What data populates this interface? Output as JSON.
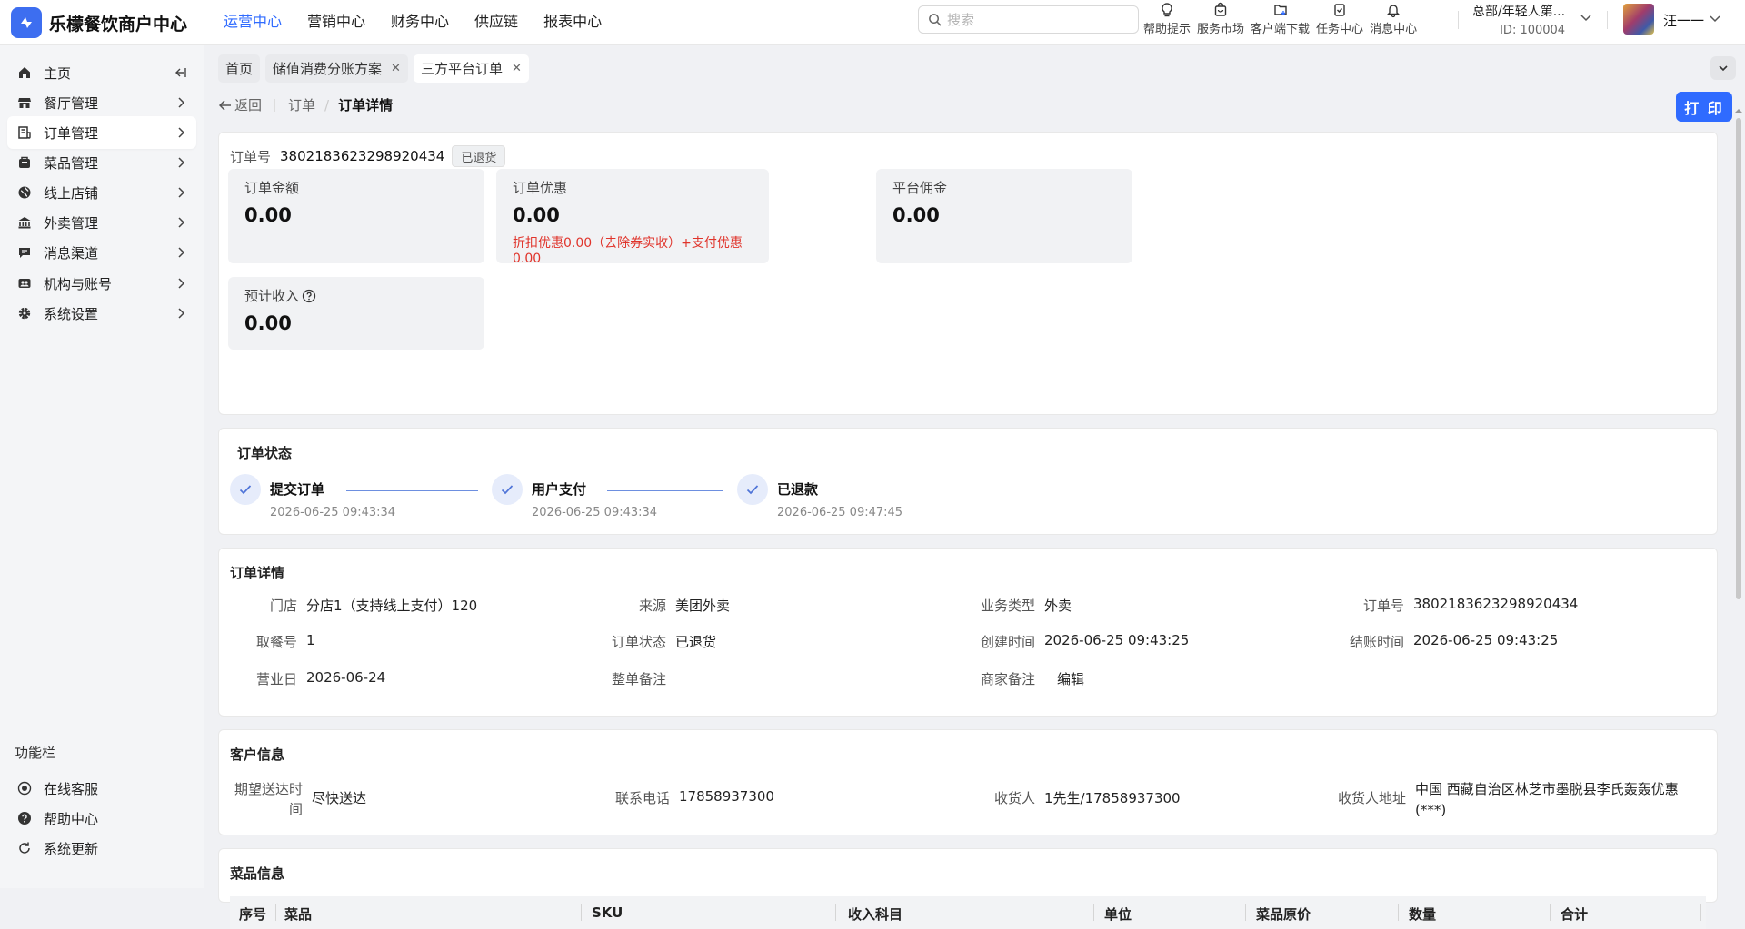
{
  "app": {
    "title": "乐檬餐饮商户中心"
  },
  "topnav": [
    "运营中心",
    "营销中心",
    "财务中心",
    "供应链",
    "报表中心"
  ],
  "search": {
    "placeholder": "搜索"
  },
  "tools": [
    {
      "label": "帮助提示",
      "icon": "lightbulb-icon"
    },
    {
      "label": "服务市场",
      "icon": "shop-bag-icon"
    },
    {
      "label": "客户端下载",
      "icon": "folder-download-icon"
    },
    {
      "label": "任务中心",
      "icon": "clipboard-icon"
    },
    {
      "label": "消息中心",
      "icon": "bell-icon"
    }
  ],
  "org": {
    "name": "总部/年轻人第...",
    "id": "ID: 100004"
  },
  "user": {
    "name": "汪一一"
  },
  "sidebar": {
    "items": [
      {
        "label": "主页",
        "icon": "home-icon"
      },
      {
        "label": "餐厅管理",
        "icon": "store-icon"
      },
      {
        "label": "订单管理",
        "icon": "order-icon"
      },
      {
        "label": "菜品管理",
        "icon": "dish-icon"
      },
      {
        "label": "线上店铺",
        "icon": "globe-icon"
      },
      {
        "label": "外卖管理",
        "icon": "bank-icon"
      },
      {
        "label": "消息渠道",
        "icon": "chat-icon"
      },
      {
        "label": "机构与账号",
        "icon": "org-icon"
      },
      {
        "label": "系统设置",
        "icon": "gear-icon"
      }
    ],
    "section_title": "功能栏",
    "bottom": [
      {
        "label": "在线客服",
        "icon": "headset-icon"
      },
      {
        "label": "帮助中心",
        "icon": "help-icon"
      },
      {
        "label": "系统更新",
        "icon": "refresh-icon"
      }
    ]
  },
  "tabs": [
    {
      "label": "首页"
    },
    {
      "label": "储值消费分账方案"
    },
    {
      "label": "三方平台订单"
    }
  ],
  "breadcrumb": {
    "back": "返回",
    "parent": "订单",
    "current": "订单详情"
  },
  "print_label": "打 印",
  "order": {
    "no_label": "订单号",
    "no": "3802183623298920434",
    "status_badge": "已退货",
    "stats": [
      {
        "label": "订单金额",
        "value": "0.00"
      },
      {
        "label": "订单优惠",
        "value": "0.00",
        "detail": "折扣优惠0.00（去除券实收）+支付优惠0.00"
      },
      {
        "label": "平台佣金",
        "value": "0.00"
      },
      {
        "label": "预计收入",
        "value": "0.00"
      }
    ]
  },
  "status": {
    "title": "订单状态",
    "steps": [
      {
        "label": "提交订单",
        "time": "2026-06-25 09:43:34"
      },
      {
        "label": "用户支付",
        "time": "2026-06-25 09:43:34"
      },
      {
        "label": "已退款",
        "time": "2026-06-25 09:47:45"
      }
    ]
  },
  "detail": {
    "title": "订单详情",
    "fields": [
      {
        "k": "门店",
        "v": "分店1（支持线上支付）120"
      },
      {
        "k": "来源",
        "v": "美团外卖"
      },
      {
        "k": "业务类型",
        "v": "外卖"
      },
      {
        "k": "订单号",
        "v": "3802183623298920434"
      },
      {
        "k": "取餐号",
        "v": "1"
      },
      {
        "k": "订单状态",
        "v": "已退货"
      },
      {
        "k": "创建时间",
        "v": "2026-06-25 09:43:25"
      },
      {
        "k": "结账时间",
        "v": "2026-06-25 09:43:25"
      },
      {
        "k": "营业日",
        "v": "2026-06-24"
      },
      {
        "k": "整单备注",
        "v": ""
      },
      {
        "k": "商家备注",
        "v": "编辑"
      }
    ]
  },
  "customer": {
    "title": "客户信息",
    "fields": [
      {
        "k": "期望送达时间",
        "v": "尽快送达"
      },
      {
        "k": "联系电话",
        "v": "17858937300"
      },
      {
        "k": "收货人",
        "v": "1先生/17858937300"
      },
      {
        "k": "收货人地址",
        "v": "中国 西藏自治区林芝市墨脱县李氏轰轰优惠(***)"
      }
    ]
  },
  "dishes": {
    "title": "菜品信息",
    "columns": [
      "序号",
      "菜品",
      "SKU",
      "收入科目",
      "单位",
      "菜品原价",
      "数量",
      "合计"
    ]
  },
  "colors": {
    "accent": "#2f6bff",
    "discount_red": "#e0342b"
  }
}
